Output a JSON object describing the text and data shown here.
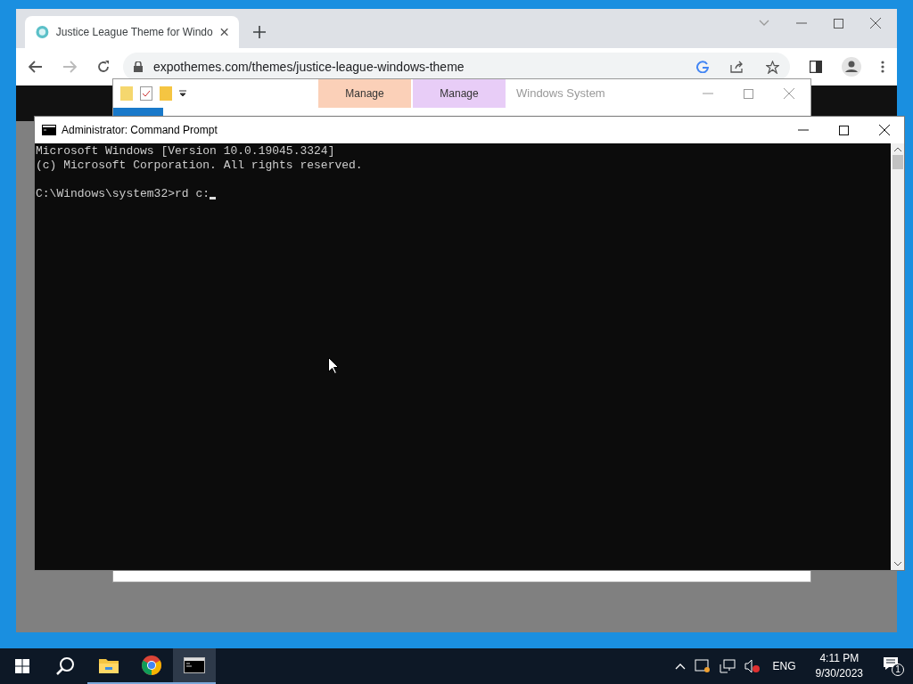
{
  "browser": {
    "tab": {
      "title": "Justice League Theme for Windo",
      "selected": true
    },
    "url": "expothemes.com/themes/justice-league-windows-theme"
  },
  "explorer": {
    "context_tabs": [
      {
        "label": "Manage",
        "color": "#fbd0b8"
      },
      {
        "label": "Manage",
        "color": "#e8cdf7"
      }
    ],
    "title": "Windows System"
  },
  "console": {
    "title": "Administrator: Command Prompt",
    "output": [
      "Microsoft Windows [Version 10.0.19045.3324]",
      "(c) Microsoft Corporation. All rights reserved."
    ],
    "prompt": "C:\\Windows\\system32>rd c:"
  },
  "taskbar": {
    "apps": [
      {
        "kind": "explorer",
        "selected": false
      },
      {
        "kind": "chrome",
        "selected": false
      },
      {
        "kind": "console",
        "selected": true
      }
    ],
    "language": "ENG",
    "time": "4:11 PM",
    "date": "9/30/2023",
    "notifications": "1"
  }
}
